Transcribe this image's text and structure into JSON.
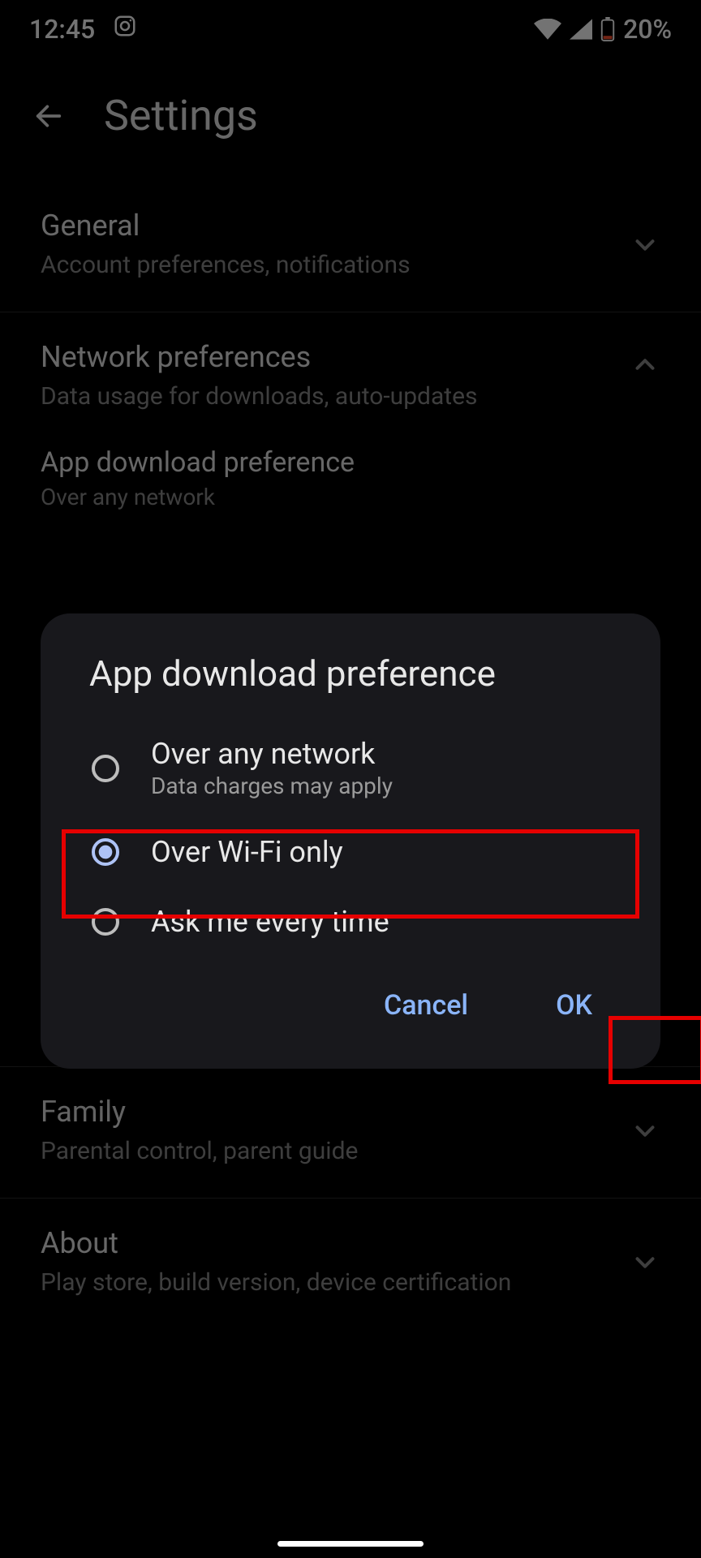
{
  "status": {
    "time": "12:45",
    "battery_text": "20%"
  },
  "header": {
    "title": "Settings"
  },
  "sections": [
    {
      "title": "General",
      "sub": "Account preferences, notifications",
      "expanded": false
    },
    {
      "title": "Network preferences",
      "sub": "Data usage for downloads, auto-updates",
      "expanded": true
    },
    {
      "title": "Family",
      "sub": "Parental control, parent guide",
      "expanded": false
    },
    {
      "title": "About",
      "sub": "Play store, build version, device certification",
      "expanded": false
    }
  ],
  "sub_item": {
    "title": "App download preference",
    "value": "Over any network"
  },
  "dialog": {
    "title": "App download preference",
    "options": [
      {
        "label": "Over any network",
        "sub": "Data charges may apply",
        "selected": false
      },
      {
        "label": "Over Wi-Fi only",
        "sub": "",
        "selected": true
      },
      {
        "label": "Ask me every time",
        "sub": "",
        "selected": false
      }
    ],
    "cancel": "Cancel",
    "ok": "OK"
  },
  "colors": {
    "accent": "#8ab4f8",
    "highlight": "#e60000",
    "dialog_bg": "#18181c"
  }
}
